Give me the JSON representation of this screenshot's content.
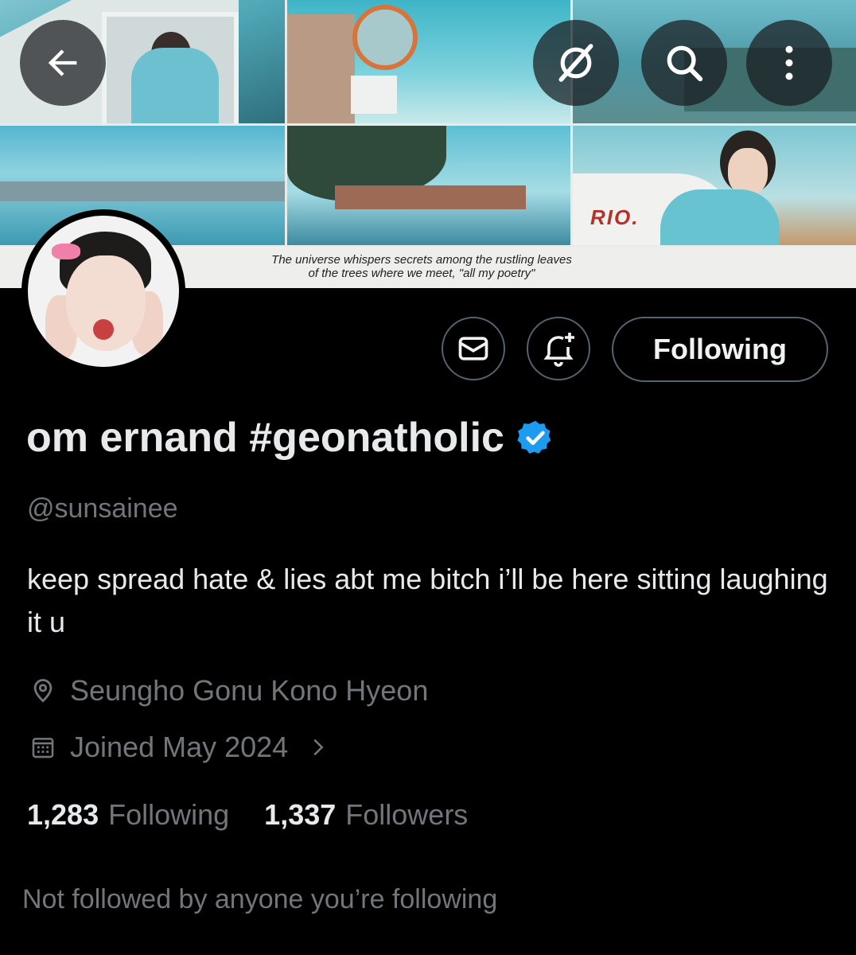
{
  "banner": {
    "quote_line1": "The universe whispers secrets among the rustling leaves",
    "quote_line2": "of the trees where we meet, \"all my poetry\"",
    "boat_text": "RIO."
  },
  "toolbar": {
    "back_icon": "arrow-left-icon",
    "grok_icon": "grok-icon",
    "search_icon": "search-icon",
    "more_icon": "more-vertical-icon"
  },
  "actions": {
    "message_icon": "envelope-icon",
    "notify_icon": "bell-plus-icon",
    "follow_label": "Following"
  },
  "profile": {
    "display_name": "om ernand #geonatholic",
    "verified": true,
    "verified_color": "#1d9bf0",
    "handle": "@sunsainee",
    "bio": "keep spread hate & lies abt me bitch i’ll be here sitting laughing it u",
    "location": "Seungho Gonu Kono Hyeon",
    "joined": "Joined May 2024",
    "following_count": "1,283",
    "following_label": "Following",
    "followers_count": "1,337",
    "followers_label": "Followers",
    "followed_by": "Not followed by anyone you’re following"
  },
  "colors": {
    "background": "#000000",
    "text_primary": "#e7e9ea",
    "text_secondary": "#71767b",
    "border": "#536471"
  }
}
